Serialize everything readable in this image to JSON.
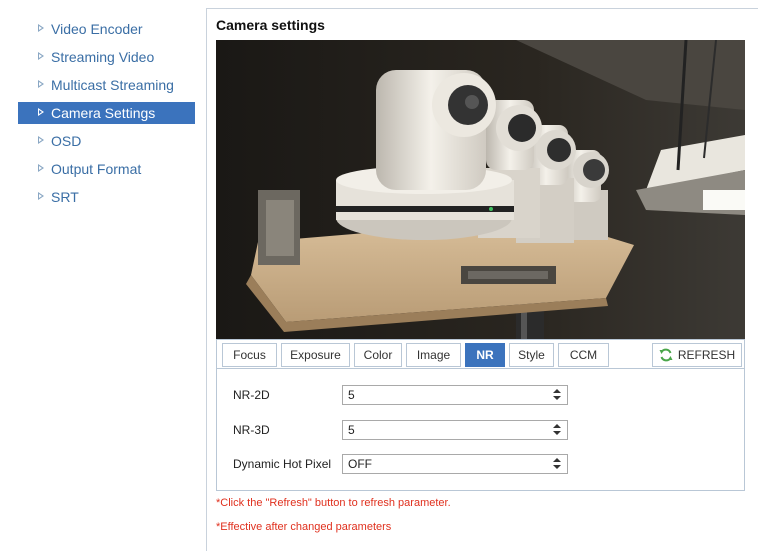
{
  "sidebar": {
    "items": [
      {
        "label": "Video Encoder",
        "active": false
      },
      {
        "label": "Streaming Video",
        "active": false
      },
      {
        "label": "Multicast Streaming",
        "active": false
      },
      {
        "label": "Camera Settings",
        "active": true
      },
      {
        "label": "OSD",
        "active": false
      },
      {
        "label": "Output Format",
        "active": false
      },
      {
        "label": "SRT",
        "active": false
      }
    ]
  },
  "main": {
    "title": "Camera settings",
    "tabs": [
      {
        "label": "Focus"
      },
      {
        "label": "Exposure"
      },
      {
        "label": "Color"
      },
      {
        "label": "Image"
      },
      {
        "label": "NR",
        "active": true
      },
      {
        "label": "Style"
      },
      {
        "label": "CCM"
      }
    ],
    "refresh_label": "REFRESH",
    "fields": [
      {
        "label": "NR-2D",
        "value": "5"
      },
      {
        "label": "NR-3D",
        "value": "5"
      },
      {
        "label": "Dynamic Hot Pixel",
        "value": "OFF"
      }
    ],
    "notes": [
      "*Click the \"Refresh\" button to refresh parameter.",
      "*Effective after changed parameters"
    ]
  },
  "colors": {
    "accent": "#3b73bd",
    "link": "#3a6ea5",
    "note": "#e0301e",
    "border": "#b9c7d6"
  }
}
